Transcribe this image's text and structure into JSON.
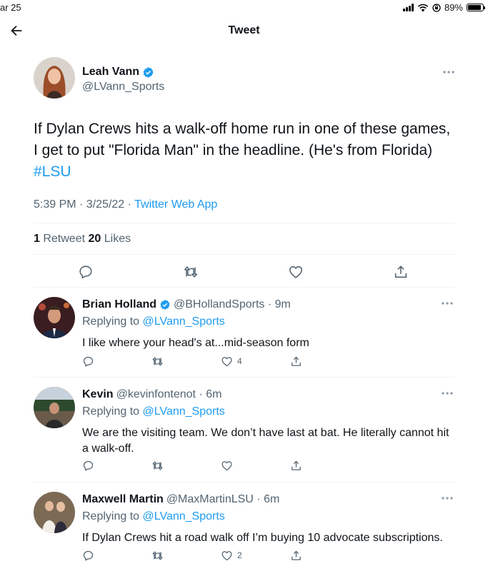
{
  "status": {
    "time": "ar 25",
    "battery": "89%",
    "battery_level": 0.89
  },
  "header": {
    "title": "Tweet"
  },
  "tweet": {
    "name": "Leah Vann",
    "handle": "@LVann_Sports",
    "text": "If Dylan Crews hits a walk-off home run in one of these games, I get to put \"Florida Man\" in the headline. (He's from Florida) ",
    "hashtag": "#LSU",
    "time": "5:39 PM · 3/25/22 · ",
    "app": "Twitter Web App",
    "retweets": "1",
    "retweets_label": " Retweet ",
    "likes": "20",
    "likes_label": " Likes"
  },
  "replies": [
    {
      "name": "Brian Holland",
      "verified": true,
      "handle": "@BHollandSports · 9m",
      "replying_prefix": "Replying to ",
      "replying_to": "@LVann_Sports",
      "text": "I like where your head's at...mid-season form",
      "likes": "4"
    },
    {
      "name": "Kevin",
      "verified": false,
      "handle": "@kevinfontenot · 6m",
      "replying_prefix": "Replying to ",
      "replying_to": "@LVann_Sports",
      "text": "We are the visiting team. We don’t have last at bat. He literally cannot hit a walk-off.",
      "likes": ""
    },
    {
      "name": "Maxwell Martin",
      "verified": false,
      "handle": "@MaxMartinLSU · 6m",
      "replying_prefix": "Replying to ",
      "replying_to": "@LVann_Sports",
      "text": "If Dylan Crews hit a road walk off I’m buying 10 advocate subscriptions.",
      "likes": "2"
    }
  ],
  "colors": {
    "accent": "#1d9bf0",
    "secondary_text": "#536471",
    "divider": "#eff3f4"
  }
}
